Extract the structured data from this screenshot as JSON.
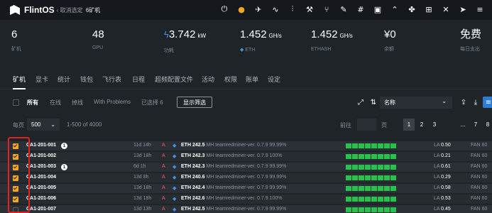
{
  "topbar": {
    "logo_text": "FlintOS",
    "breadcrumb_cancel": "取消选定",
    "breadcrumb_count": "6矿机",
    "icons": [
      "power-icon",
      "warning-icon",
      "rocket-icon",
      "wave-icon",
      "sliders-icon",
      "tools-icon",
      "branch-icon",
      "pen-icon",
      "hash-icon",
      "terminal-icon",
      "chart-icon",
      "fan-icon",
      "grid-icon",
      "wrench-icon",
      "send-icon",
      "menu-icon"
    ],
    "icon_glyphs": [
      "⏻",
      "●",
      "✈",
      "∿",
      "⫶",
      "⚒",
      "⑂",
      "✎",
      "#",
      "▣",
      "⌃",
      "✤",
      "⊞",
      "✕",
      "➤",
      "≡"
    ]
  },
  "stats": [
    {
      "value": "6",
      "unit": "",
      "label": "矿机"
    },
    {
      "value": "48",
      "unit": "",
      "label": "GPU"
    },
    {
      "value": "3.742",
      "unit": "kW",
      "label": "功耗",
      "icon": "bolt-icon"
    },
    {
      "value": "1.452",
      "unit": "GH/s",
      "label": "ETH",
      "label_icon": "eth-icon"
    },
    {
      "value": "1.452",
      "unit": "GH/s",
      "label": "ETHASH"
    },
    {
      "value": "¥0",
      "unit": "",
      "label": "余额"
    },
    {
      "value": "免费",
      "unit": "",
      "label": "每日支出"
    }
  ],
  "tabs": [
    "矿机",
    "显卡",
    "统计",
    "钱包",
    "飞行表",
    "日程",
    "超频配置文件",
    "活动",
    "权限",
    "账单",
    "设定"
  ],
  "filters": {
    "all": "所有",
    "online": "在线",
    "offline": "掉线",
    "with_problems": "With Problems",
    "selected": "已选择 6",
    "show_filter_button": "显示筛选",
    "sort_value": "名称"
  },
  "pager": {
    "per_page_label": "每页",
    "per_page_value": "500",
    "range": "1-500 of 4000",
    "goto_label": "前往",
    "page_label": "页",
    "pages": [
      "1",
      "2",
      "3",
      "...",
      "7",
      "8"
    ]
  },
  "rows": [
    {
      "name": "CA1-201-001",
      "badge": "1",
      "uptime": "11d 14h",
      "vendor": "A",
      "coin": "ETH",
      "hashrate": "242.5",
      "unit": "MH",
      "miner": "teamredminer-ver. 0.7.9",
      "efficiency": "99.99%",
      "la_label": "LA",
      "la": "0.50",
      "fan_label": "FAN",
      "fan": "60",
      "checked": true
    },
    {
      "name": "CA1-201-002",
      "badge": "",
      "uptime": "13d 18h",
      "vendor": "A",
      "coin": "ETH",
      "hashrate": "242.3",
      "unit": "MH",
      "miner": "teamredminer-ver. 0.7.9",
      "efficiency": "100%",
      "la_label": "LA",
      "la": "0.21",
      "fan_label": "FAN",
      "fan": "60",
      "checked": true
    },
    {
      "name": "CA1-201-003",
      "badge": "1",
      "uptime": "6d 1h",
      "vendor": "A",
      "coin": "ETH",
      "hashrate": "242.3",
      "unit": "MH",
      "miner": "teamredminer-ver. 0.7.9",
      "efficiency": "99.99%",
      "la_label": "LA",
      "la": "0.61",
      "fan_label": "FAN",
      "fan": "60",
      "checked": true
    },
    {
      "name": "CA1-201-004",
      "badge": "",
      "uptime": "13d 8h",
      "vendor": "A",
      "coin": "ETH",
      "hashrate": "240.6",
      "unit": "MH",
      "miner": "teamredminer-ver. 0.7.9",
      "efficiency": "99.99%",
      "la_label": "LA",
      "la": "0.29",
      "fan_label": "FAN",
      "fan": "60",
      "checked": true
    },
    {
      "name": "CA1-201-005",
      "badge": "",
      "uptime": "13d 18h",
      "vendor": "A",
      "coin": "ETH",
      "hashrate": "242.4",
      "unit": "MH",
      "miner": "teamredminer-ver. 0.7.9",
      "efficiency": "99.99%",
      "la_label": "LA",
      "la": "0.58",
      "fan_label": "FAN",
      "fan": "60",
      "checked": true
    },
    {
      "name": "CA1-201-006",
      "badge": "",
      "uptime": "13d 18h",
      "vendor": "A",
      "coin": "ETH",
      "hashrate": "242.6",
      "unit": "MH",
      "miner": "teamredminer-ver. 0.7.9",
      "efficiency": "100%",
      "la_label": "LA",
      "la": "0.53",
      "fan_label": "FAN",
      "fan": "60",
      "checked": true
    },
    {
      "name": "CA1-201-007",
      "badge": "",
      "uptime": "13d 13h",
      "vendor": "A",
      "coin": "ETH",
      "hashrate": "242.5",
      "unit": "MH",
      "miner": "teamredminer-ver. 0.7.9",
      "efficiency": "99.99%",
      "la_label": "LA",
      "la": "0.45",
      "fan_label": "FAN",
      "fan": "60",
      "checked": false
    }
  ],
  "colors": {
    "accent": "#f5a623",
    "ok_bar": "#27c24c",
    "selection_outline": "#e0231f",
    "eth_blue": "#4a90e2"
  }
}
